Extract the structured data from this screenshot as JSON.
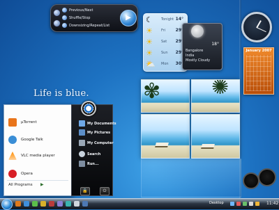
{
  "desktop": {
    "slogan": "Life is blue."
  },
  "media_player": {
    "tracks": [
      {
        "label": "Previous/Next"
      },
      {
        "label": "Shuffle/Stop"
      },
      {
        "label": "Downsizing/Repeat/List"
      }
    ]
  },
  "forecast": {
    "days": [
      {
        "day": "Tonight",
        "temp": "14°",
        "icon": "moon-cloud-icon"
      },
      {
        "day": "Fri",
        "temp": "29°",
        "icon": "sun-icon"
      },
      {
        "day": "Sat",
        "temp": "29°",
        "icon": "sun-icon"
      },
      {
        "day": "Sun",
        "temp": "29°",
        "icon": "sun-icon"
      },
      {
        "day": "Mon",
        "temp": "30°",
        "icon": "sun-cloud-icon"
      }
    ]
  },
  "weather_now": {
    "temp": "18°",
    "city": "Bangalore",
    "country": "India",
    "condition": "Mostly Cloudy"
  },
  "calendar": {
    "month": "January 2007"
  },
  "start_menu": {
    "programs": [
      {
        "label": "µTorrent",
        "color": "#e9751b"
      },
      {
        "label": "Google Talk",
        "color": "#3a8ed6"
      },
      {
        "label": "VLC media player",
        "color": "#ff8c00"
      },
      {
        "label": "Opera",
        "color": "#d81f26"
      }
    ],
    "all_programs": "All Programs",
    "right_links": [
      {
        "label": "My Documents",
        "icon": "folder-icon"
      },
      {
        "label": "My Pictures",
        "icon": "pictures-icon"
      },
      {
        "label": "My Computer",
        "icon": "computer-icon"
      },
      {
        "label": "Search",
        "icon": "search-icon"
      },
      {
        "label": "Run...",
        "icon": "run-icon"
      }
    ]
  },
  "taskbar": {
    "desktop_label": "Desktop",
    "time": "11:42"
  },
  "colors": {
    "desktop_blue": "#1d72c2",
    "calendar_orange": "#f08a2c",
    "taskbar_dark": "#0f1620"
  }
}
